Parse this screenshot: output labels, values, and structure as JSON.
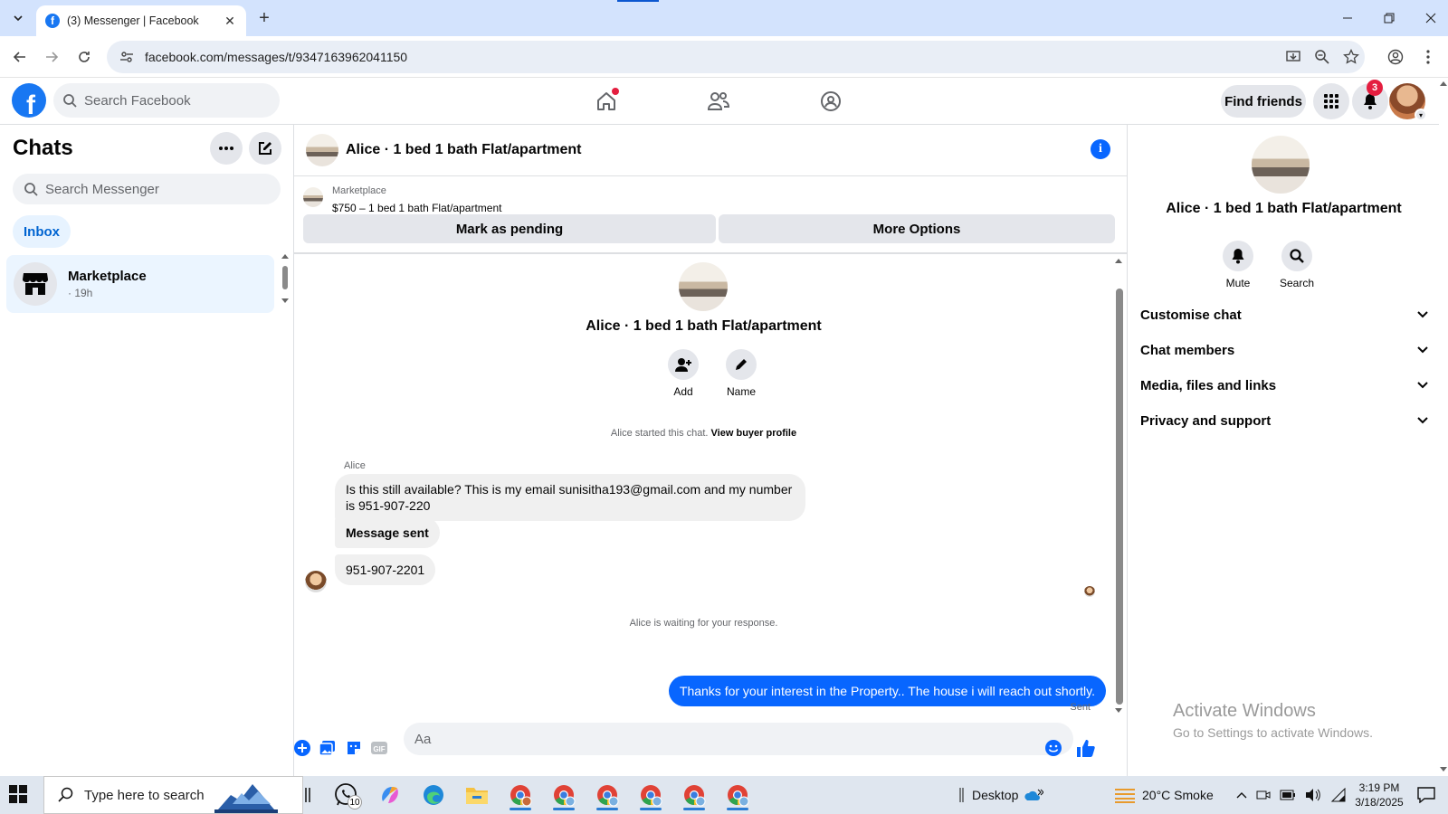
{
  "browser": {
    "tab_title": "(3) Messenger | Facebook",
    "url": "facebook.com/messages/t/9347163962041150"
  },
  "fb": {
    "search_placeholder": "Search Facebook",
    "find_friends": "Find friends",
    "notification_count": "3",
    "home_has_dot": true
  },
  "sidebar": {
    "title": "Chats",
    "search_placeholder": "Search Messenger",
    "tab_inbox": "Inbox",
    "chats": [
      {
        "name": "Marketplace",
        "time": "· 19h"
      }
    ]
  },
  "conversation": {
    "title": "Alice · 1 bed 1 bath Flat/apartment",
    "listing": {
      "source": "Marketplace",
      "price_title": "$750 – 1 bed 1 bath Flat/apartment",
      "mark_pending": "Mark as pending",
      "more_options": "More Options"
    },
    "profile": {
      "name": "Alice · 1 bed 1 bath Flat/apartment",
      "add_label": "Add",
      "name_label": "Name"
    },
    "started_text": "Alice started this chat.",
    "view_buyer_profile": "View buyer profile",
    "sender_name": "Alice",
    "messages_in": [
      "Is this still available? This is my email sunisitha193@gmail.com and my number is 951-907-220",
      "Message sent",
      "951-907-2201"
    ],
    "waiting_text": "Alice is waiting for your response.",
    "message_out": "Thanks for your interest in the Property.. The house i will reach  out shortly.",
    "sent_label": "Sent",
    "input_placeholder": "Aa"
  },
  "info_panel": {
    "name": "Alice · 1 bed 1 bath Flat/apartment",
    "mute_label": "Mute",
    "search_label": "Search",
    "sections": [
      "Customise chat",
      "Chat members",
      "Media, files and links",
      "Privacy and support"
    ],
    "watermark_line1": "Activate Windows",
    "watermark_line2": "Go to Settings to activate Windows."
  },
  "taskbar": {
    "search_placeholder": "Type here to search",
    "whatsapp_badge": "10",
    "desktop_label": "Desktop",
    "weather": "20°C  Smoke",
    "time": "3:19 PM",
    "date": "3/18/2025"
  },
  "colors": {
    "fb_blue": "#1877f2",
    "messenger_blue": "#0866ff",
    "notification_red": "#e41e3f"
  }
}
